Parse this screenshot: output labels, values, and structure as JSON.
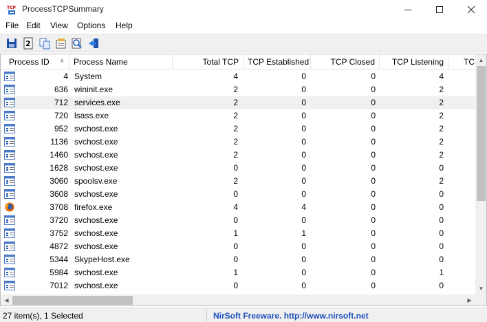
{
  "window": {
    "title": "ProcessTCPSummary"
  },
  "menu": [
    "File",
    "Edit",
    "View",
    "Options",
    "Help"
  ],
  "toolbar": [
    "save-icon",
    "html-report-icon",
    "copy-icon",
    "properties-icon",
    "find-icon",
    "exit-icon"
  ],
  "columns": [
    "Process ID",
    "Process Name",
    "Total TCP",
    "TCP Established",
    "TCP Closed",
    "TCP Listening",
    "TCI"
  ],
  "rows": [
    {
      "icon": "process-icon",
      "pid": "4",
      "name": "System",
      "total": "4",
      "established": "0",
      "closed": "0",
      "listening": "4"
    },
    {
      "icon": "process-icon",
      "pid": "636",
      "name": "wininit.exe",
      "total": "2",
      "established": "0",
      "closed": "0",
      "listening": "2"
    },
    {
      "icon": "process-icon",
      "pid": "712",
      "name": "services.exe",
      "total": "2",
      "established": "0",
      "closed": "0",
      "listening": "2"
    },
    {
      "icon": "process-icon",
      "pid": "720",
      "name": "lsass.exe",
      "total": "2",
      "established": "0",
      "closed": "0",
      "listening": "2"
    },
    {
      "icon": "process-icon",
      "pid": "952",
      "name": "svchost.exe",
      "total": "2",
      "established": "0",
      "closed": "0",
      "listening": "2"
    },
    {
      "icon": "process-icon",
      "pid": "1136",
      "name": "svchost.exe",
      "total": "2",
      "established": "0",
      "closed": "0",
      "listening": "2"
    },
    {
      "icon": "process-icon",
      "pid": "1460",
      "name": "svchost.exe",
      "total": "2",
      "established": "0",
      "closed": "0",
      "listening": "2"
    },
    {
      "icon": "process-icon",
      "pid": "1628",
      "name": "svchost.exe",
      "total": "0",
      "established": "0",
      "closed": "0",
      "listening": "0"
    },
    {
      "icon": "process-icon",
      "pid": "3060",
      "name": "spoolsv.exe",
      "total": "2",
      "established": "0",
      "closed": "0",
      "listening": "2"
    },
    {
      "icon": "process-icon",
      "pid": "3608",
      "name": "svchost.exe",
      "total": "0",
      "established": "0",
      "closed": "0",
      "listening": "0"
    },
    {
      "icon": "firefox-icon",
      "pid": "3708",
      "name": "firefox.exe",
      "total": "4",
      "established": "4",
      "closed": "0",
      "listening": "0"
    },
    {
      "icon": "process-icon",
      "pid": "3720",
      "name": "svchost.exe",
      "total": "0",
      "established": "0",
      "closed": "0",
      "listening": "0"
    },
    {
      "icon": "process-icon",
      "pid": "3752",
      "name": "svchost.exe",
      "total": "1",
      "established": "1",
      "closed": "0",
      "listening": "0"
    },
    {
      "icon": "process-icon",
      "pid": "4872",
      "name": "svchost.exe",
      "total": "0",
      "established": "0",
      "closed": "0",
      "listening": "0"
    },
    {
      "icon": "process-icon",
      "pid": "5344",
      "name": "SkypeHost.exe",
      "total": "0",
      "established": "0",
      "closed": "0",
      "listening": "0"
    },
    {
      "icon": "process-icon",
      "pid": "5984",
      "name": "svchost.exe",
      "total": "1",
      "established": "0",
      "closed": "0",
      "listening": "1"
    },
    {
      "icon": "process-icon",
      "pid": "7012",
      "name": "svchost.exe",
      "total": "0",
      "established": "0",
      "closed": "0",
      "listening": "0"
    }
  ],
  "selected_row": 2,
  "status": {
    "count": "27 item(s), 1 Selected",
    "link": "NirSoft Freeware.  http://www.nirsoft.net"
  }
}
